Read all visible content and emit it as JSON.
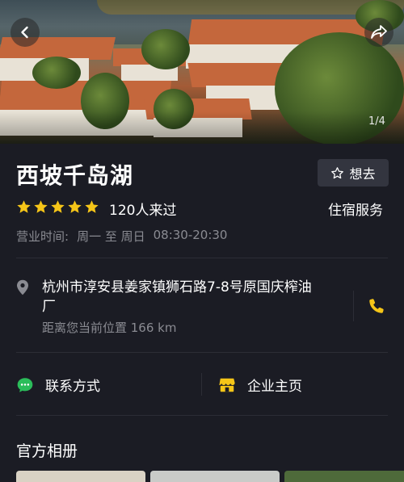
{
  "hero": {
    "counter": "1/4",
    "back_icon": "chevron-left-icon",
    "share_icon": "share-icon"
  },
  "place": {
    "title": "西坡千岛湖",
    "want_label": "想去",
    "rating_stars": 5,
    "visits": "120人来过",
    "category": "住宿服务",
    "hours_label": "营业时间:",
    "hours_days": "周一 至 周日",
    "hours_time": "08:30-20:30"
  },
  "location": {
    "address": "杭州市淳安县姜家镇狮石路7-8号原国庆榨油厂",
    "distance": "距离您当前位置 166 km"
  },
  "actions": {
    "contact_label": "联系方式",
    "company_label": "企业主页"
  },
  "album": {
    "title": "官方相册"
  },
  "colors": {
    "background": "#1b1c24",
    "star": "#f5c518",
    "phone": "#f5c518",
    "contact_icon": "#2bbd5a",
    "company_icon": "#f5c518",
    "muted_text": "#8a8b92"
  }
}
